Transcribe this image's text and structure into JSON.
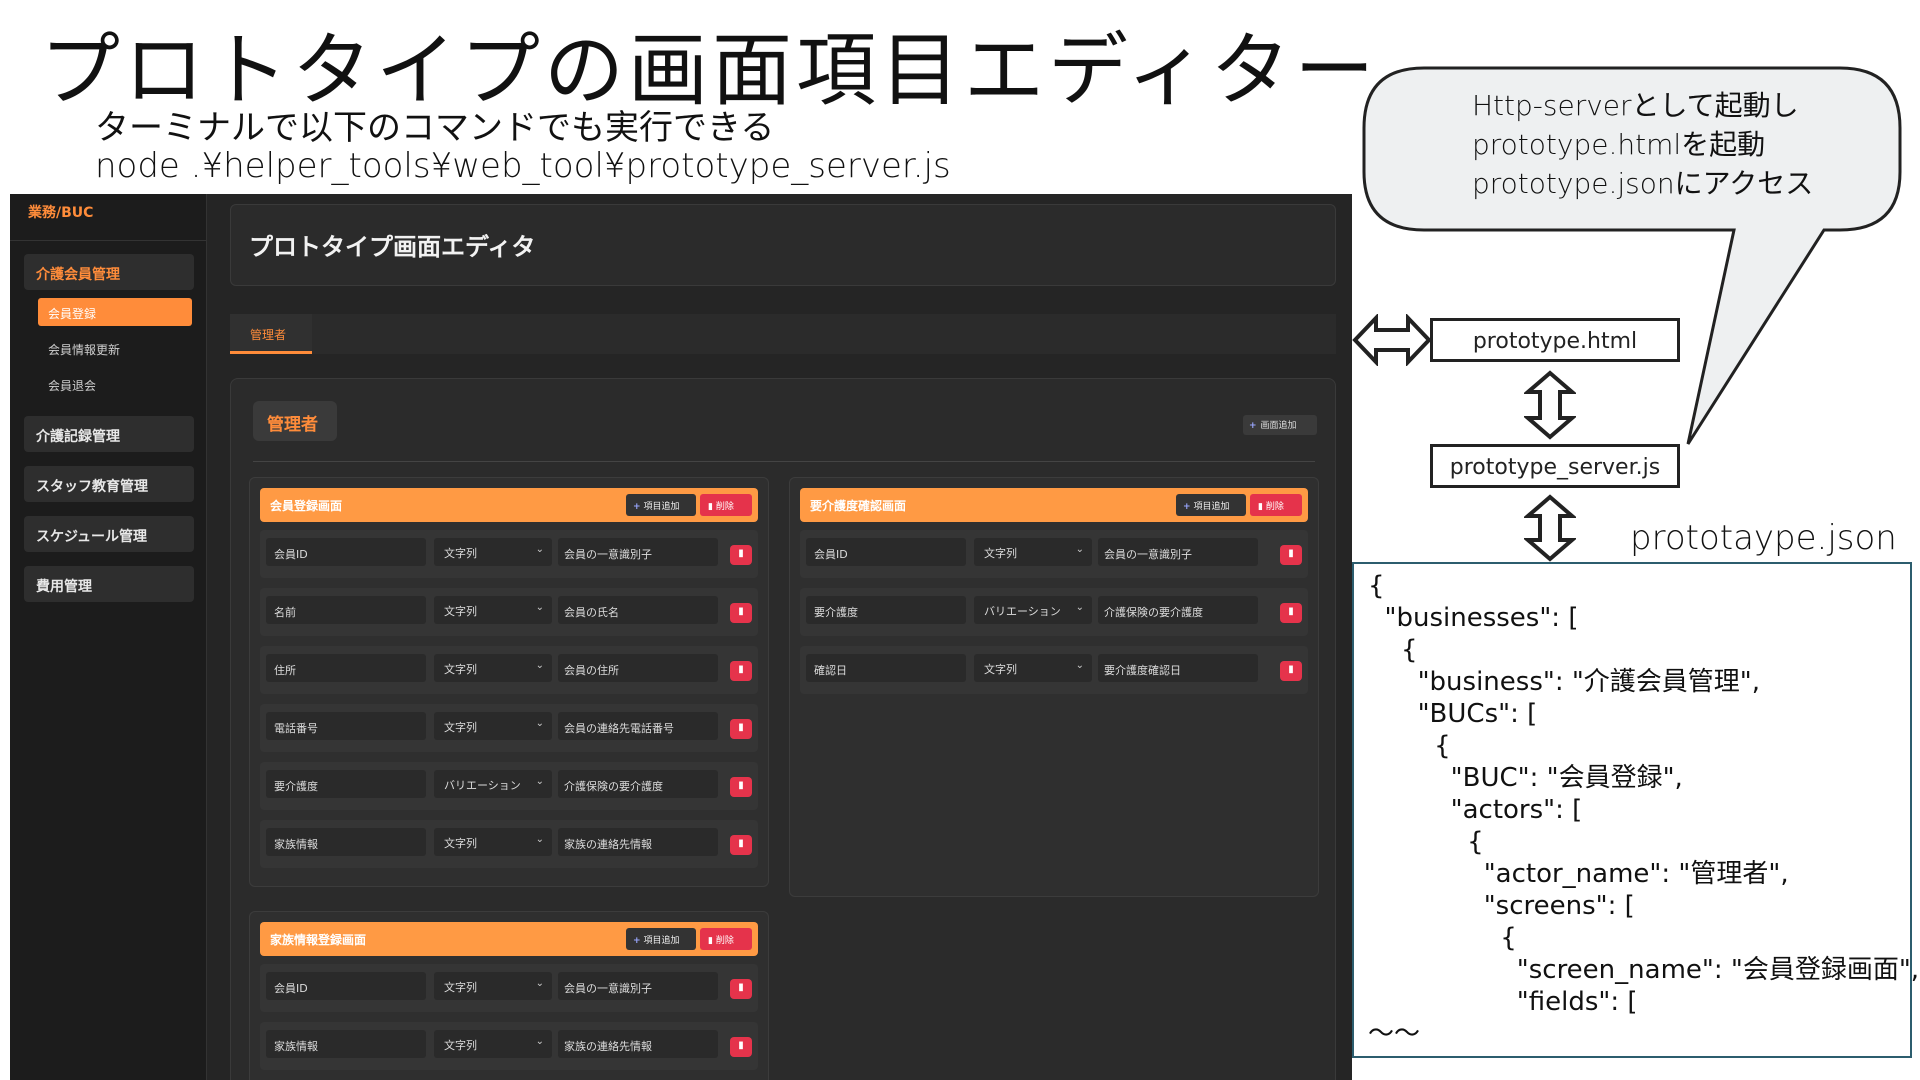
{
  "slide": {
    "title": "プロトタイプの画面項目エディター",
    "subtitle1": "ターミナルで以下のコマンドでも実行できる",
    "subtitle2": "node .¥helper_tools¥web_tool¥prototype_server.js"
  },
  "sidebar": {
    "brand": "業務/BUC",
    "groups": [
      {
        "label": "介護会員管理"
      },
      {
        "label": "介護記録管理"
      },
      {
        "label": "スタッフ教育管理"
      },
      {
        "label": "スケジュール管理"
      },
      {
        "label": "費用管理"
      }
    ],
    "subitems": [
      {
        "label": "会員登録"
      },
      {
        "label": "会員情報更新"
      },
      {
        "label": "会員退会"
      }
    ]
  },
  "header": {
    "title": "プロトタイプ画面エディタ"
  },
  "tabs": [
    {
      "label": "管理者"
    }
  ],
  "main": {
    "actor": "管理者",
    "add_screen_label": "画面追加",
    "add_item_label": "項目追加",
    "delete_label": "削除",
    "screens": [
      {
        "name": "会員登録画面",
        "fields": [
          {
            "name": "会員ID",
            "type": "文字列",
            "desc": "会員の一意識別子"
          },
          {
            "name": "名前",
            "type": "文字列",
            "desc": "会員の氏名"
          },
          {
            "name": "住所",
            "type": "文字列",
            "desc": "会員の住所"
          },
          {
            "name": "電話番号",
            "type": "文字列",
            "desc": "会員の連絡先電話番号"
          },
          {
            "name": "要介護度",
            "type": "バリエーション",
            "desc": "介護保険の要介護度"
          },
          {
            "name": "家族情報",
            "type": "文字列",
            "desc": "家族の連絡先情報"
          }
        ]
      },
      {
        "name": "要介護度確認画面",
        "fields": [
          {
            "name": "会員ID",
            "type": "文字列",
            "desc": "会員の一意識別子"
          },
          {
            "name": "要介護度",
            "type": "バリエーション",
            "desc": "介護保険の要介護度"
          },
          {
            "name": "確認日",
            "type": "文字列",
            "desc": "要介護度確認日"
          }
        ]
      },
      {
        "name": "家族情報登録画面",
        "fields": [
          {
            "name": "会員ID",
            "type": "文字列",
            "desc": "会員の一意識別子"
          },
          {
            "name": "家族情報",
            "type": "文字列",
            "desc": "家族の連絡先情報"
          }
        ]
      }
    ]
  },
  "diagram": {
    "box1": "prototype.html",
    "box2": "prototype_server.js",
    "json_label": "prototaype.json",
    "bubble_lines": [
      "Http-serverとして起動し",
      "prototype.htmlを起動",
      "prototype.jsonにアクセス"
    ],
    "json_lines": [
      "{",
      "  \"businesses\": [",
      "    {",
      "      \"business\": \"介護会員管理\",",
      "      \"BUCs\": [",
      "        {",
      "          \"BUC\": \"会員登録\",",
      "          \"actors\": [",
      "            {",
      "              \"actor_name\": \"管理者\",",
      "              \"screens\": [",
      "                {",
      "                  \"screen_name\": \"会員登録画面\",",
      "                  \"fields\": [",
      "〜〜"
    ]
  },
  "icons": {
    "plus": "plus-icon",
    "trash": "trash-icon",
    "chevron": "chevron-down-icon",
    "arrow": "double-arrow-icon"
  },
  "colors": {
    "accent": "#ff8c3a",
    "danger": "#e5334b",
    "app_bg": "#252525",
    "json_border": "#2c5d6e"
  }
}
